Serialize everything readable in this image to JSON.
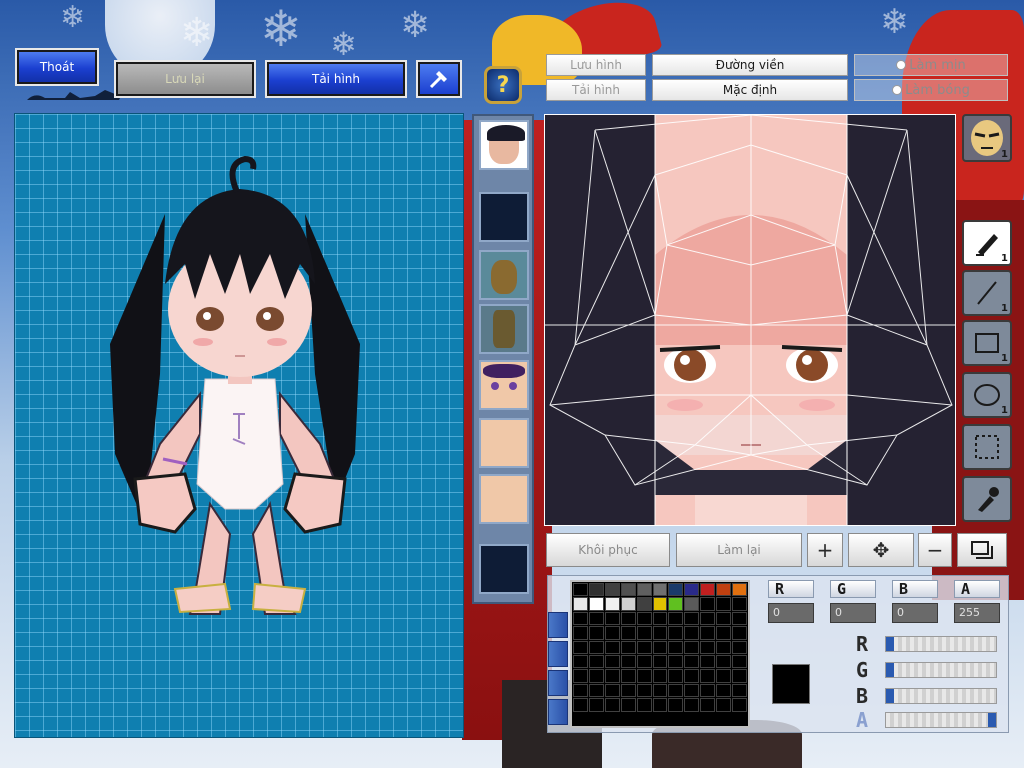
{
  "top_bar": {
    "exit_label": "Thoát",
    "save_label": "Lưu lại",
    "reload_label": "Tải hình",
    "hammer_icon": "hammer-icon",
    "help_label": "?"
  },
  "editor_tabs": {
    "save_image": "Lưu hình",
    "load_image": "Tải hình",
    "outline": "Đường viền",
    "default": "Mặc định",
    "smooth": "Làm mịn",
    "shine": "Làm bóng"
  },
  "thumbnails": [
    {
      "name": "face-thumb-1",
      "tone": "#e8b8a0"
    },
    {
      "name": "empty-thumb-2",
      "tone": "#0e1c36"
    },
    {
      "name": "mask-thumb-3",
      "tone": "#8a6a30"
    },
    {
      "name": "body-thumb-4",
      "tone": "#6a5a30"
    },
    {
      "name": "face-thumb-5",
      "tone": "#f0c8a8"
    },
    {
      "name": "skin-thumb-6",
      "tone": "#f0c8a8"
    },
    {
      "name": "skin-thumb-7",
      "tone": "#f0c8a8"
    },
    {
      "name": "empty-thumb-8",
      "tone": "#0e1c36"
    }
  ],
  "tools": [
    {
      "name": "avatar-tool",
      "count": "1"
    },
    {
      "name": "brush-tool",
      "count": "1"
    },
    {
      "name": "line-tool",
      "count": "1"
    },
    {
      "name": "rect-tool",
      "count": "1"
    },
    {
      "name": "ellipse-tool",
      "count": "1"
    },
    {
      "name": "select-tool",
      "count": ""
    },
    {
      "name": "eyedropper-tool",
      "count": ""
    }
  ],
  "bottom_buttons": {
    "restore_label": "Khôi phục",
    "redo_label": "Làm lại"
  },
  "color": {
    "r_label": "R",
    "g_label": "G",
    "b_label": "B",
    "a_label": "A",
    "r_value": "0",
    "g_value": "0",
    "b_value": "0",
    "a_value": "255",
    "current": "#000000",
    "palette": [
      "#000000",
      "#303030",
      "#404040",
      "#505050",
      "#606060",
      "#707070",
      "#1a3a6a",
      "#2a2a8a",
      "#c02020",
      "#c04010",
      "#e07010",
      "#e8e8e8",
      "#ffffff",
      "#f0f0f0",
      "#d0d0d0",
      "#404040",
      "#e0c000",
      "#60c020",
      "#5a5a5a"
    ],
    "slider_levels": {
      "r": 0,
      "g": 0,
      "b": 0,
      "a": 1
    }
  }
}
